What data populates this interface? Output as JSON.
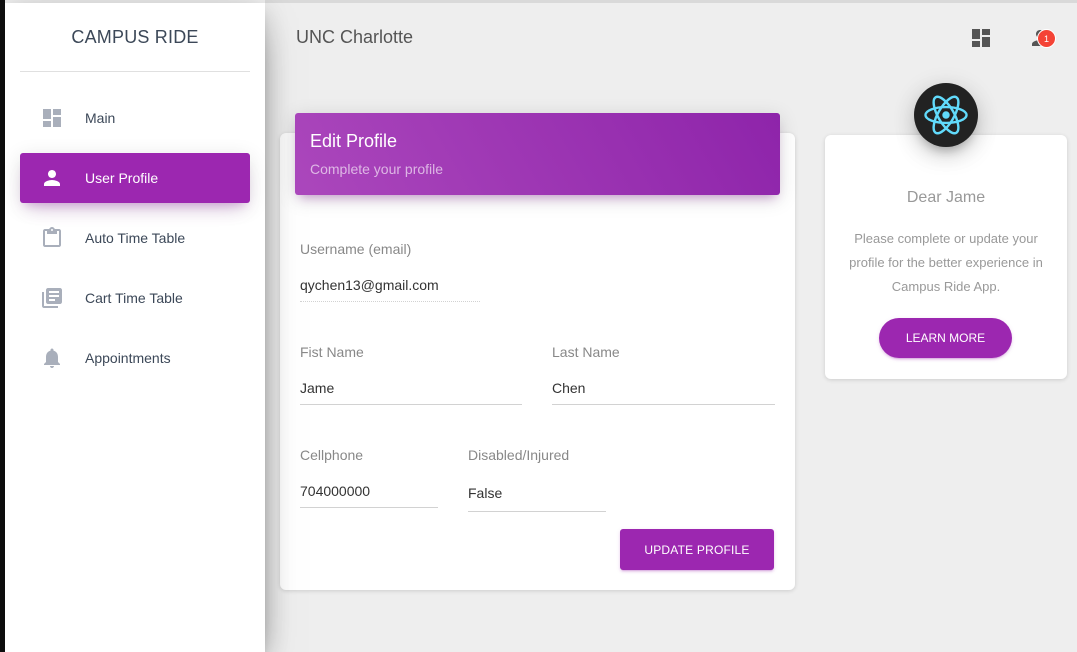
{
  "sidebar": {
    "brand": "CAMPUS RIDE",
    "items": [
      {
        "label": "Main",
        "icon": "dashboard-icon",
        "active": false
      },
      {
        "label": "User Profile",
        "icon": "person-icon",
        "active": true
      },
      {
        "label": "Auto Time Table",
        "icon": "clipboard-icon",
        "active": false
      },
      {
        "label": "Cart Time Table",
        "icon": "library-books-icon",
        "active": false
      },
      {
        "label": "Appointments",
        "icon": "bell-icon",
        "active": false
      }
    ]
  },
  "topbar": {
    "title": "UNC Charlotte",
    "notification_count": "1",
    "icons": [
      "dashboard-icon",
      "person-icon"
    ]
  },
  "edit_profile": {
    "title": "Edit Profile",
    "subtitle": "Complete your profile",
    "fields": {
      "username": {
        "label": "Username (email)",
        "value": "qychen13@gmail.com"
      },
      "first_name": {
        "label": "Fist Name",
        "value": "Jame"
      },
      "last_name": {
        "label": "Last Name",
        "value": "Chen"
      },
      "cellphone": {
        "label": "Cellphone",
        "value": "704000000"
      },
      "disabled": {
        "label": "Disabled/Injured",
        "value": "False"
      }
    },
    "update_button": "UPDATE PROFILE"
  },
  "profile_card": {
    "greeting": "Dear Jame",
    "description": "Please complete or update your profile for the better experience in Campus Ride App.",
    "learn_more": "LEARN MORE",
    "avatar_icon": "react-logo-icon"
  },
  "colors": {
    "accent": "#9c27b0",
    "badge": "#f44336",
    "react": "#61dafb"
  }
}
